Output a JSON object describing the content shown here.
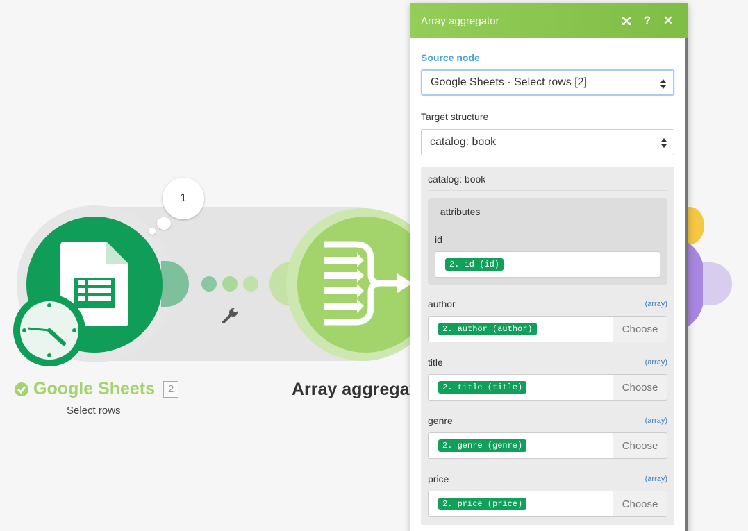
{
  "scenario": {
    "bubble_count": "1",
    "source_module": {
      "name": "Google Sheets",
      "badge": "2",
      "subtitle": "Select rows",
      "icon": "google-sheets-icon",
      "color": "#109d58"
    },
    "aggregator_module": {
      "name": "Array aggregator",
      "icon": "array-aggregator-icon",
      "color": "#a3d46b"
    }
  },
  "panel": {
    "title": "Array aggregator",
    "header_buttons": [
      "expand-icon",
      "help-icon",
      "close-icon"
    ],
    "source_node_label": "Source node",
    "source_node_value": "Google Sheets - Select rows [2]",
    "target_structure_label": "Target structure",
    "target_structure_value": "catalog: book",
    "structure": {
      "title": "catalog: book",
      "attributes": {
        "title": "_attributes",
        "field_label": "id",
        "field_value": "2. id (id)"
      },
      "fields": [
        {
          "label": "author",
          "tag": "(array)",
          "value": "2. author (author)",
          "button": "Choose"
        },
        {
          "label": "title",
          "tag": "(array)",
          "value": "2. title (title)",
          "button": "Choose"
        },
        {
          "label": "genre",
          "tag": "(array)",
          "value": "2. genre (genre)",
          "button": "Choose"
        },
        {
          "label": "price",
          "tag": "(array)",
          "value": "2. price (price)",
          "button": "Choose"
        }
      ]
    }
  },
  "colors": {
    "header_green": "#8cc751",
    "pill_green": "#11a05a",
    "link_blue": "#4aa3df"
  }
}
